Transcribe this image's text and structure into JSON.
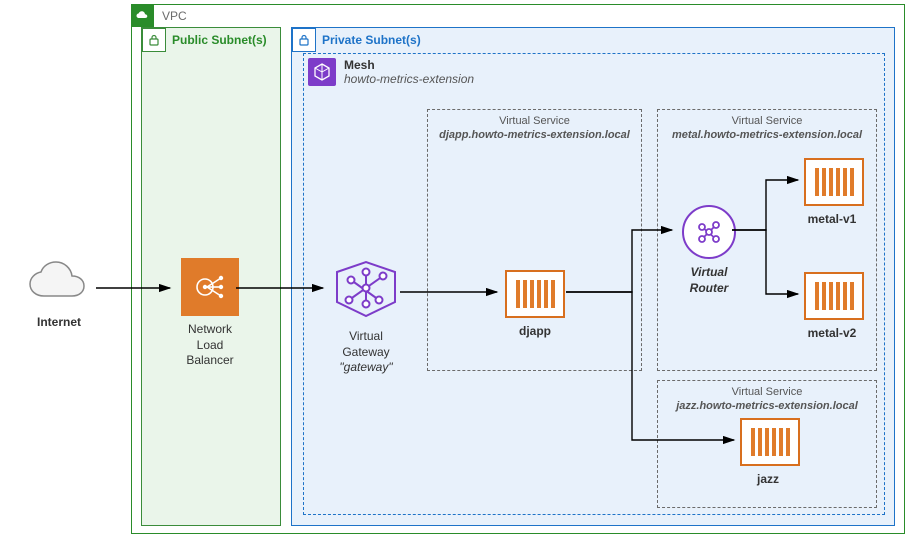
{
  "internet": {
    "label": "Internet"
  },
  "vpc": {
    "label": "VPC"
  },
  "public_subnet": {
    "label": "Public Subnet(s)"
  },
  "private_subnet": {
    "label": "Private Subnet(s)"
  },
  "mesh": {
    "title": "Mesh",
    "name": "howto-metrics-extension"
  },
  "nlb": {
    "label": "Network Load Balancer"
  },
  "gateway": {
    "label1": "Virtual Gateway",
    "label2": "\"gateway\""
  },
  "virtual_services": {
    "djapp": {
      "title": "Virtual Service",
      "hostname": "djapp.howto-metrics-extension.local"
    },
    "metal": {
      "title": "Virtual Service",
      "hostname": "metal.howto-metrics-extension.local"
    },
    "jazz": {
      "title": "Virtual Service",
      "hostname": "jazz.howto-metrics-extension.local"
    }
  },
  "router": {
    "label": "Virtual Router"
  },
  "nodes": {
    "djapp": "djapp",
    "metal_v1": "metal-v1",
    "metal_v2": "metal-v2",
    "jazz": "jazz"
  },
  "colors": {
    "vpc_border": "#2a8c2a",
    "subnet_public": "#eaf5ea",
    "subnet_private": "#e8f1fb",
    "aws_orange": "#e07b2a",
    "mesh_purple": "#7d3cc9",
    "private_blue": "#1e73c8"
  }
}
